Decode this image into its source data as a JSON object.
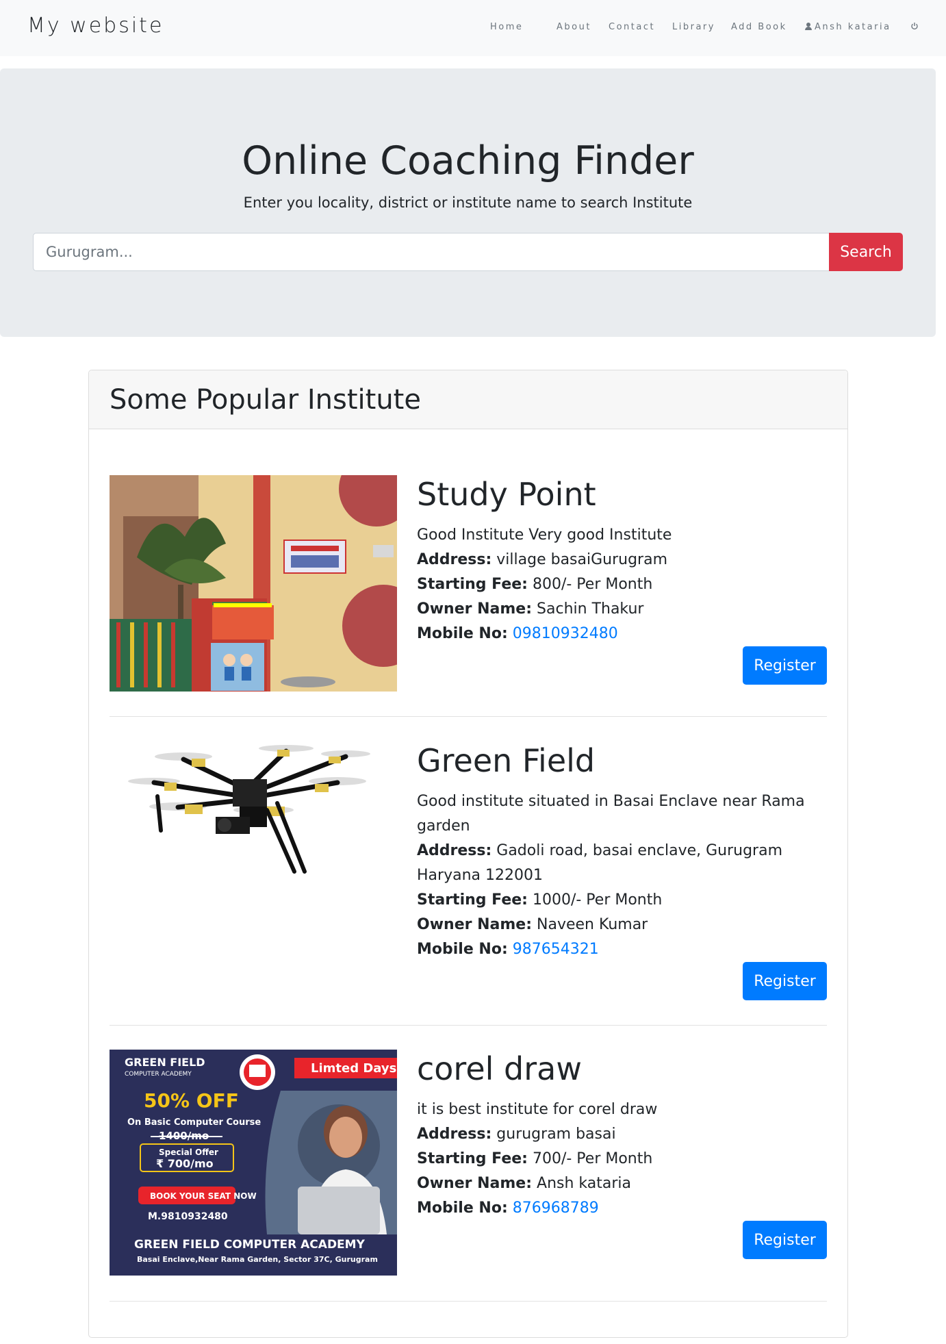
{
  "navbar": {
    "brand": "My website",
    "items": [
      {
        "label": "Home"
      },
      {
        "label": "About"
      },
      {
        "label": "Contact"
      },
      {
        "label": "Library"
      },
      {
        "label": "Add Book"
      },
      {
        "label": "Ansh kataria",
        "icon": "user-icon"
      },
      {
        "label": "",
        "icon": "power-icon"
      }
    ]
  },
  "hero": {
    "title": "Online Coaching Finder",
    "subtitle": "Enter you locality, district or institute name to search Institute",
    "search_placeholder": "Gurugram...",
    "search_value": "",
    "search_button": "Search"
  },
  "popular": {
    "heading": "Some Popular Institute",
    "labels": {
      "address": "Address:",
      "fee": "Starting Fee:",
      "owner": "Owner Name:",
      "mobile": "Mobile No:"
    },
    "register_label": "Register",
    "institutes": [
      {
        "name": "Study Point",
        "description": "Good Institute Very good Institute",
        "address": "village basaiGurugram",
        "fee": "800/- Per Month",
        "owner": "Sachin Thakur",
        "mobile": "09810932480",
        "image": "building-photo"
      },
      {
        "name": "Green Field",
        "description": "Good institute situated in Basai Enclave near Rama garden",
        "address": "Gadoli road, basai enclave, Gurugram Haryana 122001",
        "fee": "1000/- Per Month",
        "owner": "Naveen Kumar",
        "mobile": "987654321",
        "image": "drone-photo"
      },
      {
        "name": "corel draw",
        "description": "it is best institute for corel draw",
        "address": "gurugram basai",
        "fee": "700/- Per Month",
        "owner": "Ansh kataria",
        "mobile": "876968789",
        "image": "academy-poster"
      }
    ]
  },
  "poster": {
    "brand_line1": "GREEN FIELD",
    "brand_line2": "COMPUTER ACADEMY",
    "badge": "Limted Days",
    "discount": "50% OFF",
    "course": "On Basic Computer Course",
    "old_price": "1400/mo",
    "offer_label": "Special Offer",
    "offer_price": "₹ 700/mo",
    "cta": "BOOK YOUR SEAT NOW",
    "phone": "M.9810932480",
    "footer_title": "GREEN FIELD COMPUTER ACADEMY",
    "footer_address": "Basai Enclave,Near Rama Garden, Sector 37C, Gurugram",
    "colors": {
      "bg": "#2b2f5a",
      "accent": "#f5c518",
      "red": "#e8242b"
    }
  },
  "colors": {
    "primary": "#007bff",
    "danger": "#dc3545",
    "jumbotron": "#e9ecef",
    "navbar": "#f8f9fa"
  }
}
